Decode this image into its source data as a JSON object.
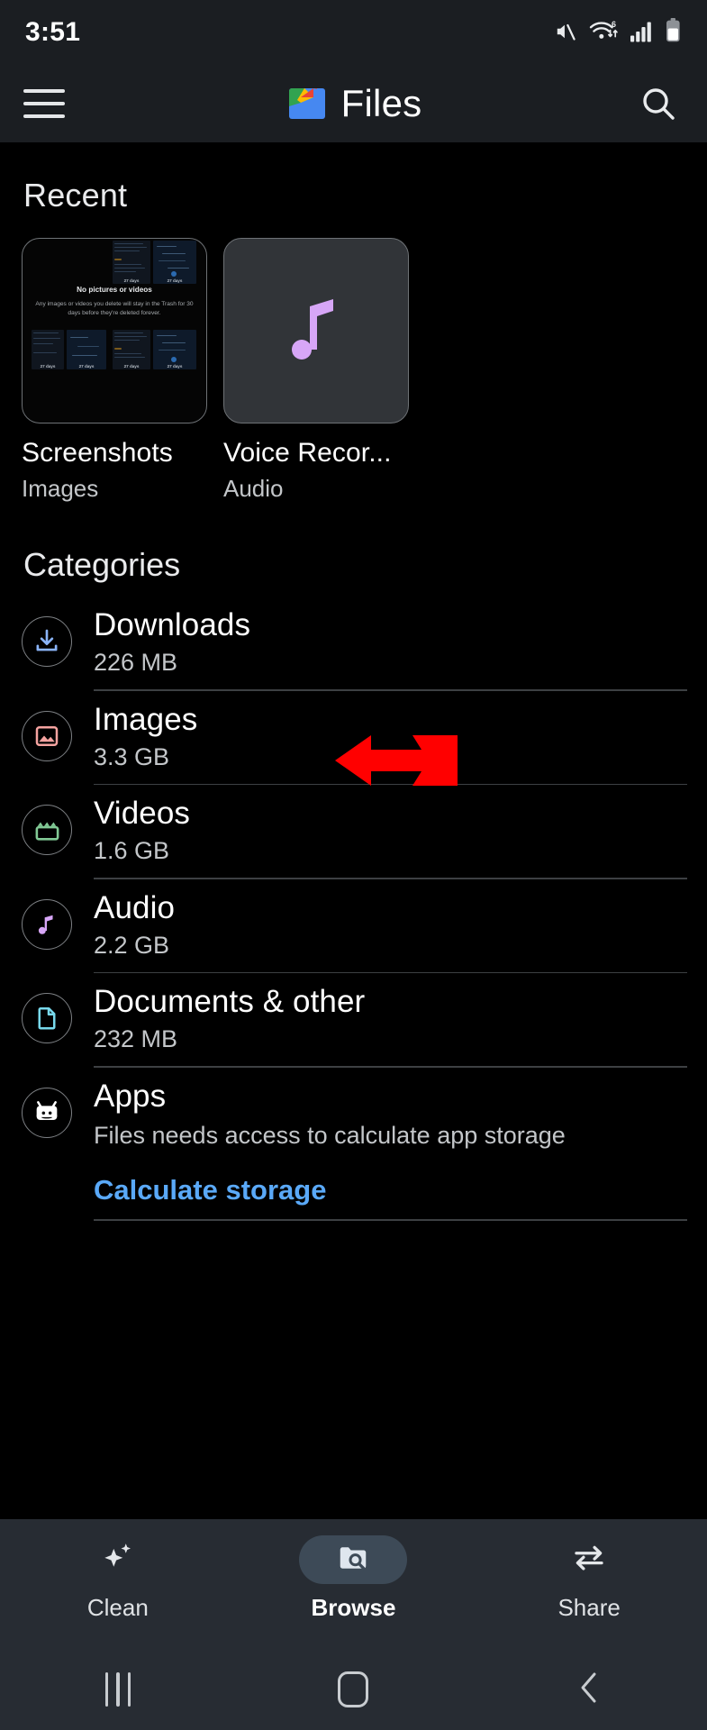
{
  "status_bar": {
    "time": "3:51",
    "icons": [
      "mute-icon",
      "wifi6-icon",
      "signal-icon",
      "battery-icon"
    ]
  },
  "app_bar": {
    "menu_icon": "hamburger-menu-icon",
    "logo_icon": "files-by-google-logo",
    "title": "Files",
    "search_icon": "search-icon"
  },
  "recent": {
    "heading": "Recent",
    "items": [
      {
        "name": "Screenshots",
        "type": "Images",
        "thumb_kind": "screenshot-collage",
        "inner_title": "No pictures or videos",
        "inner_subtitle": "Any images or videos you delete will stay in the Trash for 30 days before they're deleted forever.",
        "inner_tile_caption": "27 days"
      },
      {
        "name": "Voice Recor...",
        "type": "Audio",
        "thumb_kind": "music-note-icon"
      }
    ]
  },
  "categories": {
    "heading": "Categories",
    "items": [
      {
        "name": "Downloads",
        "size": "226 MB",
        "icon": "download-icon",
        "icon_color": "#8ab4f8",
        "highlighted": true
      },
      {
        "name": "Images",
        "size": "3.3 GB",
        "icon": "image-icon",
        "icon_color": "#f5a3a0"
      },
      {
        "name": "Videos",
        "size": "1.6 GB",
        "icon": "video-clapperboard-icon",
        "icon_color": "#81c995"
      },
      {
        "name": "Audio",
        "size": "2.2 GB",
        "icon": "music-note-icon",
        "icon_color": "#d7a6f7"
      },
      {
        "name": "Documents & other",
        "size": "232 MB",
        "icon": "document-icon",
        "icon_color": "#78d9ec"
      },
      {
        "name": "Apps",
        "description": "Files needs access to calculate app storage",
        "link_label": "Calculate storage",
        "icon": "android-robot-icon",
        "icon_color": "#ffffff"
      }
    ]
  },
  "annotation": {
    "arrow": "red-left-arrow",
    "color": "#ff0000",
    "points_at": "Downloads"
  },
  "bottom_nav": {
    "items": [
      {
        "label": "Clean",
        "icon": "sparkles-icon",
        "active": false
      },
      {
        "label": "Browse",
        "icon": "folder-search-icon",
        "active": true
      },
      {
        "label": "Share",
        "icon": "swap-arrows-icon",
        "active": false
      }
    ]
  },
  "system_nav": {
    "items": [
      {
        "name": "recents-button",
        "icon": "recents-icon"
      },
      {
        "name": "home-button",
        "icon": "home-icon"
      },
      {
        "name": "back-button",
        "icon": "back-chevron-icon"
      }
    ]
  }
}
